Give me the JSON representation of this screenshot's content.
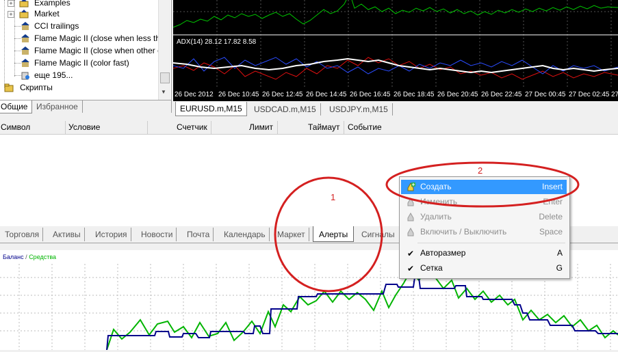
{
  "navigator": {
    "items": [
      {
        "label": "Examples",
        "icon": "folder-hat-icon"
      },
      {
        "label": "Market",
        "icon": "folder-hat-icon"
      },
      {
        "label": "CCI trailings",
        "icon": "expert-hat-icon"
      },
      {
        "label": "Flame Magic II (close when less th",
        "icon": "expert-hat-icon"
      },
      {
        "label": "Flame Magic II (close when other c",
        "icon": "expert-hat-icon"
      },
      {
        "label": "Flame Magic II (color fast)",
        "icon": "expert-hat-icon"
      },
      {
        "label": "еще 195...",
        "icon": "more-icon"
      },
      {
        "label": "Скрипты",
        "icon": "scripts-folder-icon"
      }
    ],
    "tabs": [
      "Общие",
      "Избранное"
    ]
  },
  "chart": {
    "indicator_label": "ADX(14) 28.12 17.82 8.58",
    "time_labels": [
      "26 Dec 2012",
      "26 Dec 10:45",
      "26 Dec 12:45",
      "26 Dec 14:45",
      "26 Dec 16:45",
      "26 Dec 18:45",
      "26 Dec 20:45",
      "26 Dec 22:45",
      "27 Dec 00:45",
      "27 Dec 02:45",
      "27"
    ],
    "tabs": [
      "EURUSD.m,M15",
      "USDCAD.m,M15",
      "USDJPY.m,M15"
    ],
    "colors": {
      "main": "#00c800",
      "adx": "#ffffff",
      "plus_di": "#2a4cff",
      "minus_di": "#e01010"
    }
  },
  "alerts": {
    "columns": [
      "Символ",
      "Условие",
      "Счетчик",
      "Лимит",
      "Таймаут",
      "Событие"
    ]
  },
  "terminal_tabs": [
    "Торговля",
    "Активы",
    "История",
    "Новости",
    "Почта",
    "Календарь",
    "Маркет",
    "Алерты",
    "Сигналы"
  ],
  "terminal_active_tab": "Алерты",
  "equity": {
    "legend_balance": "Баланс",
    "legend_separator": "/",
    "legend_equity": "Средства",
    "colors": {
      "balance": "#00008b",
      "equity": "#00b400"
    }
  },
  "context_menu": {
    "items": [
      {
        "label": "Создать",
        "shortcut": "Insert",
        "icon": "create-alert-icon",
        "state": "highlighted"
      },
      {
        "label": "Изменить",
        "shortcut": "Enter",
        "icon": "edit-alert-icon",
        "state": "disabled"
      },
      {
        "label": "Удалить",
        "shortcut": "Delete",
        "icon": "delete-alert-icon",
        "state": "disabled"
      },
      {
        "label": "Включить / Выключить",
        "shortcut": "Space",
        "icon": "toggle-alert-icon",
        "state": "disabled"
      },
      {
        "label": "Авторазмер",
        "shortcut": "A",
        "icon": "check-icon",
        "state": "checked"
      },
      {
        "label": "Сетка",
        "shortcut": "G",
        "icon": "check-icon",
        "state": "checked"
      }
    ]
  },
  "annotations": {
    "first": "1",
    "second": "2",
    "color": "#d42020"
  }
}
